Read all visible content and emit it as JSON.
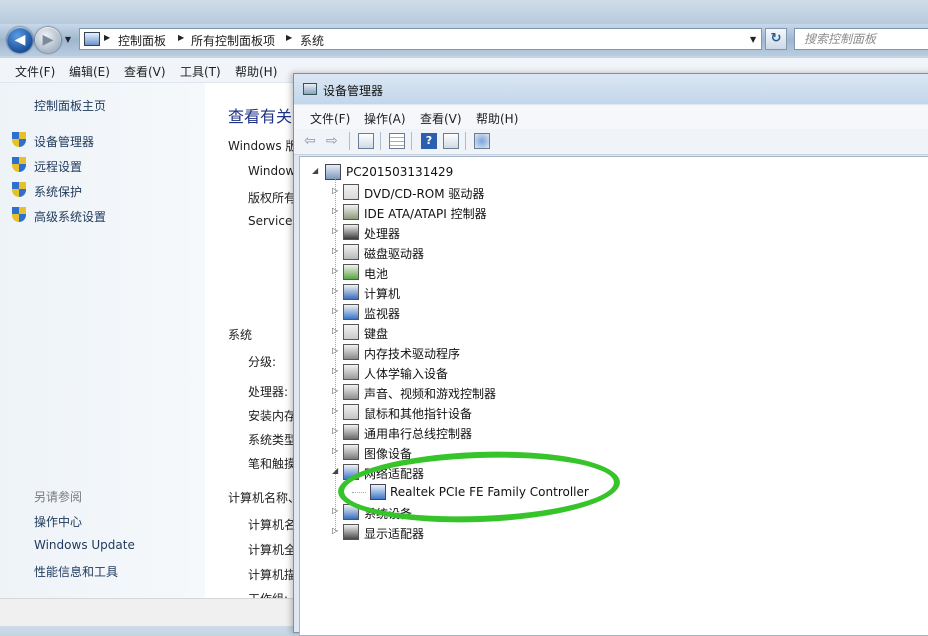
{
  "address_bar": {
    "breadcrumbs": [
      "控制面板",
      "所有控制面板项",
      "系统"
    ],
    "search_placeholder": "搜索控制面板"
  },
  "outer_menu": [
    "文件(F)",
    "编辑(E)",
    "查看(V)",
    "工具(T)",
    "帮助(H)"
  ],
  "left_panel": {
    "home_link": "控制面板主页",
    "tasks": [
      "设备管理器",
      "远程设置",
      "系统保护",
      "高级系统设置"
    ],
    "see_also_title": "另请参阅",
    "see_also": [
      "操作中心",
      "Windows Update",
      "性能信息和工具"
    ]
  },
  "main_panel": {
    "title": "查看有关",
    "windows_edition_heading": "Windows 版",
    "windows_lines": [
      "Window",
      "版权所有",
      "Service"
    ],
    "system_heading": "系统",
    "system_fields": [
      "分级:",
      "处理器:",
      "安装内存",
      "系统类型",
      "笔和触摸"
    ],
    "computer_heading": "计算机名称、",
    "computer_fields": [
      "计算机名",
      "计算机全",
      "计算机描",
      "工作组:"
    ]
  },
  "device_manager": {
    "title": "设备管理器",
    "menu": [
      "文件(F)",
      "操作(A)",
      "查看(V)",
      "帮助(H)"
    ],
    "root": "PC201503131429",
    "categories": [
      {
        "label": "DVD/CD-ROM 驱动器",
        "icon": "dvd-drive-icon"
      },
      {
        "label": "IDE ATA/ATAPI 控制器",
        "icon": "ide-controller-icon"
      },
      {
        "label": "处理器",
        "icon": "processor-icon"
      },
      {
        "label": "磁盘驱动器",
        "icon": "disk-drive-icon"
      },
      {
        "label": "电池",
        "icon": "battery-icon"
      },
      {
        "label": "计算机",
        "icon": "computer-icon"
      },
      {
        "label": "监视器",
        "icon": "monitor-icon"
      },
      {
        "label": "键盘",
        "icon": "keyboard-icon"
      },
      {
        "label": "内存技术驱动程序",
        "icon": "memory-icon"
      },
      {
        "label": "人体学输入设备",
        "icon": "hid-icon"
      },
      {
        "label": "声音、视频和游戏控制器",
        "icon": "sound-icon"
      },
      {
        "label": "鼠标和其他指针设备",
        "icon": "mouse-icon"
      },
      {
        "label": "通用串行总线控制器",
        "icon": "usb-icon"
      },
      {
        "label": "图像设备",
        "icon": "camera-icon"
      },
      {
        "label": "网络适配器",
        "icon": "network-adapter-icon",
        "expanded": true,
        "children": [
          "Realtek PCIe FE Family Controller"
        ]
      },
      {
        "label": "系统设备",
        "icon": "system-device-icon"
      },
      {
        "label": "显示适配器",
        "icon": "display-adapter-icon"
      }
    ],
    "highlight_color": "#36c42a"
  }
}
